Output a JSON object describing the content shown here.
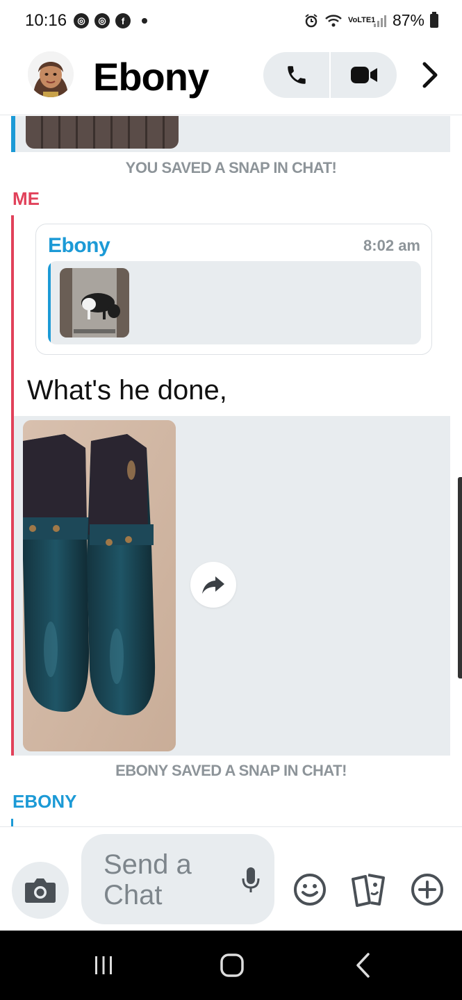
{
  "status_bar": {
    "time": "10:16",
    "battery": "87%",
    "network": "VoLTE1"
  },
  "header": {
    "contact_name": "Ebony",
    "icons": [
      "avatar",
      "phone-icon",
      "video-icon",
      "chevron-right-icon"
    ]
  },
  "chat": {
    "system_note_1": "YOU SAVED A SNAP IN CHAT!",
    "sender_me": "ME",
    "quote": {
      "name": "Ebony",
      "time": "8:02 am"
    },
    "message": "What's he done,",
    "system_note_2": "EBONY SAVED A SNAP IN CHAT!",
    "sender_ebony": "EBONY"
  },
  "input": {
    "placeholder": "Send a Chat",
    "icons": [
      "camera-icon",
      "microphone-icon",
      "emoji-icon",
      "stickers-icon",
      "plus-icon"
    ]
  },
  "colors": {
    "me": "#e1415a",
    "friend": "#1c9ad6",
    "bubble_bg": "#e8ecef",
    "muted": "#8d9499"
  }
}
